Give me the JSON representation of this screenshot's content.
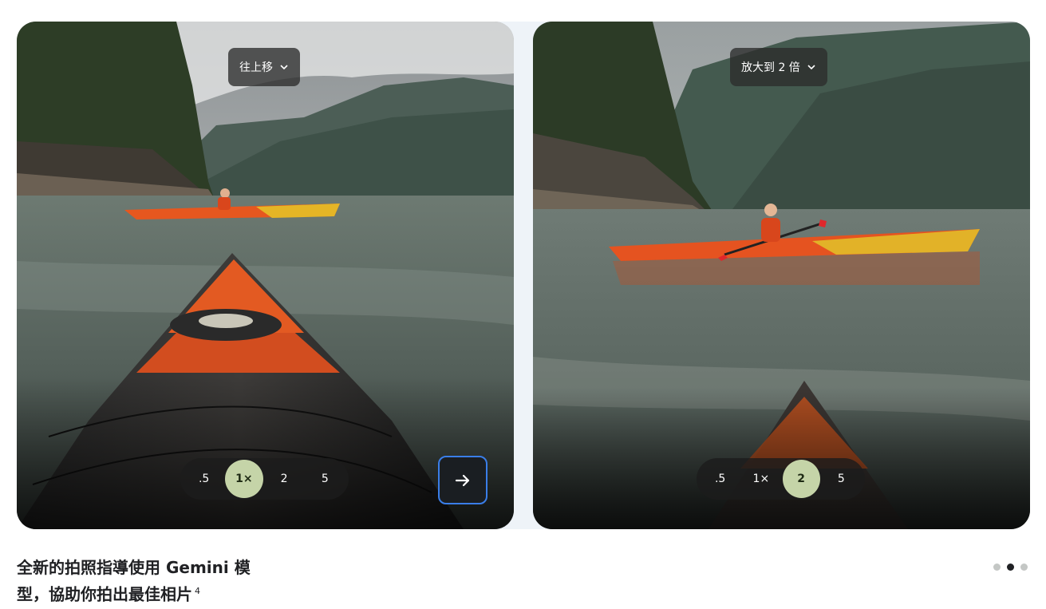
{
  "slides": [
    {
      "top_pill_label": "往上移",
      "zoom_options": [
        ".5",
        "1×",
        "2",
        "5"
      ],
      "zoom_selected": "1×"
    },
    {
      "top_pill_label": "放大到 2 倍",
      "zoom_options": [
        ".5",
        "1×",
        "2",
        "5"
      ],
      "zoom_selected": "2"
    }
  ],
  "next_button_icon": "arrow-right-icon",
  "caption": {
    "text": "全新的拍照指導使用 Gemini 模型，協助你拍出最佳相片",
    "footnote": "4"
  },
  "carousel": {
    "total_dots": 3,
    "active_dot": 2
  },
  "colors": {
    "zoom_active_bg": "#c5d4a8",
    "focus_ring": "#3a7ee8"
  }
}
